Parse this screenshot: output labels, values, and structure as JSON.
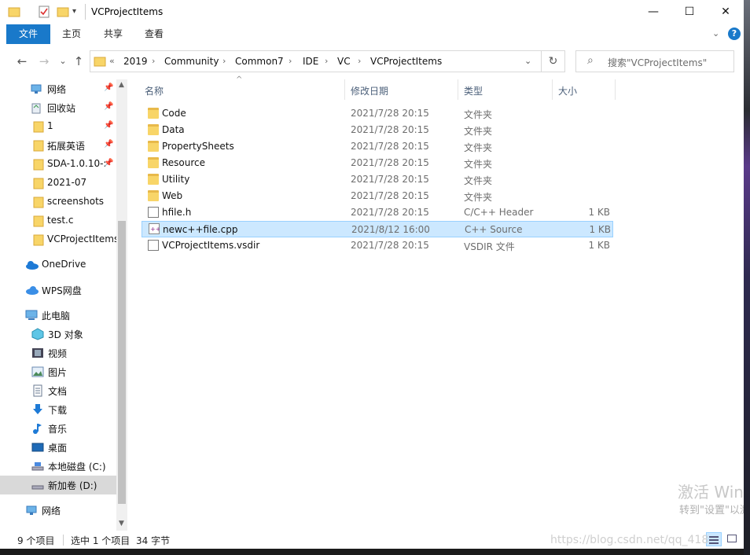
{
  "window": {
    "title": "VCProjectItems",
    "controls": {
      "minimize": "—",
      "maximize": "☐",
      "close": "✕"
    }
  },
  "ribbon": {
    "tabs": [
      {
        "label": "文件",
        "active": true
      },
      {
        "label": "主页"
      },
      {
        "label": "共享"
      },
      {
        "label": "查看"
      }
    ],
    "help": "?"
  },
  "nav": {
    "back": "←",
    "forward": "→",
    "recent": "⌄",
    "up": "↑",
    "address_prefix": "«",
    "breadcrumb": [
      "2019",
      "Community",
      "Common7",
      "IDE",
      "VC",
      "VCProjectItems"
    ],
    "search_placeholder": "搜索\"VCProjectItems\""
  },
  "sidebar": {
    "items": [
      {
        "label": "网络",
        "icon": "network-icon",
        "pinned": true
      },
      {
        "label": "回收站",
        "icon": "recycle-bin-icon",
        "pinned": true
      },
      {
        "label": "1",
        "icon": "folder-icon",
        "pinned": true
      },
      {
        "label": "拓展英语",
        "icon": "folder-icon",
        "pinned": true
      },
      {
        "label": "SDA-1.0.10-:",
        "icon": "folder-icon",
        "pinned": true
      },
      {
        "label": "2021-07",
        "icon": "folder-icon"
      },
      {
        "label": "screenshots",
        "icon": "folder-icon"
      },
      {
        "label": "test.c",
        "icon": "folder-icon"
      },
      {
        "label": "VCProjectItems",
        "icon": "folder-icon"
      },
      {
        "label": "OneDrive",
        "icon": "onedrive-icon"
      },
      {
        "label": "WPS网盘",
        "icon": "wps-cloud-icon"
      },
      {
        "label": "此电脑",
        "icon": "computer-icon"
      },
      {
        "label": "3D 对象",
        "icon": "3d-objects-icon"
      },
      {
        "label": "视频",
        "icon": "video-icon"
      },
      {
        "label": "图片",
        "icon": "picture-icon"
      },
      {
        "label": "文档",
        "icon": "document-icon"
      },
      {
        "label": "下载",
        "icon": "download-icon"
      },
      {
        "label": "音乐",
        "icon": "music-icon"
      },
      {
        "label": "桌面",
        "icon": "desktop-icon"
      },
      {
        "label": "本地磁盘 (C:)",
        "icon": "drive-icon"
      },
      {
        "label": "新加卷 (D:)",
        "icon": "drive-icon",
        "selected": true
      },
      {
        "label": "网络",
        "icon": "network-icon"
      }
    ]
  },
  "columns": {
    "name": "名称",
    "date": "修改日期",
    "type": "类型",
    "size": "大小"
  },
  "files": [
    {
      "name": "Code",
      "date": "2021/7/28 20:15",
      "type": "文件夹",
      "size": "",
      "kind": "folder"
    },
    {
      "name": "Data",
      "date": "2021/7/28 20:15",
      "type": "文件夹",
      "size": "",
      "kind": "folder"
    },
    {
      "name": "PropertySheets",
      "date": "2021/7/28 20:15",
      "type": "文件夹",
      "size": "",
      "kind": "folder"
    },
    {
      "name": "Resource",
      "date": "2021/7/28 20:15",
      "type": "文件夹",
      "size": "",
      "kind": "folder"
    },
    {
      "name": "Utility",
      "date": "2021/7/28 20:15",
      "type": "文件夹",
      "size": "",
      "kind": "folder"
    },
    {
      "name": "Web",
      "date": "2021/7/28 20:15",
      "type": "文件夹",
      "size": "",
      "kind": "folder"
    },
    {
      "name": "hfile.h",
      "date": "2021/7/28 20:15",
      "type": "C/C++ Header",
      "size": "1 KB",
      "kind": "file"
    },
    {
      "name": "newc++file.cpp",
      "date": "2021/8/12 16:00",
      "type": "C++ Source",
      "size": "1 KB",
      "kind": "cpp",
      "selected": true
    },
    {
      "name": "VCProjectItems.vsdir",
      "date": "2021/7/28 20:15",
      "type": "VSDIR 文件",
      "size": "1 KB",
      "kind": "file"
    }
  ],
  "status": {
    "count": "9 个项目",
    "selection": "选中 1 个项目",
    "bytes": "34 字节"
  },
  "overlay": {
    "activate_title": "激活 Wind",
    "activate_sub": "转到\"设置\"以激",
    "csdn_watermark": "https://blog.csdn.net/qq_418"
  }
}
